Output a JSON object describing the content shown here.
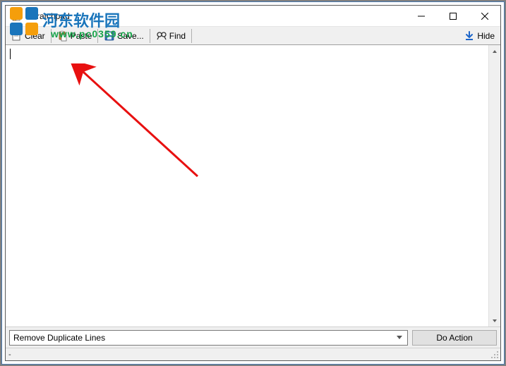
{
  "window": {
    "title": "Scratchpad"
  },
  "toolbar": {
    "clear_label": "Clear",
    "paste_label": "Paste",
    "save_label": "Save...",
    "find_label": "Find",
    "hide_label": "Hide"
  },
  "textarea": {
    "content": ""
  },
  "bottombar": {
    "selected_action": "Remove Duplicate Lines",
    "do_action_label": "Do Action"
  },
  "statusbar": {
    "text": "-"
  },
  "watermark": {
    "line1": "河东软件园",
    "line2": "www.pc0359.cn"
  }
}
